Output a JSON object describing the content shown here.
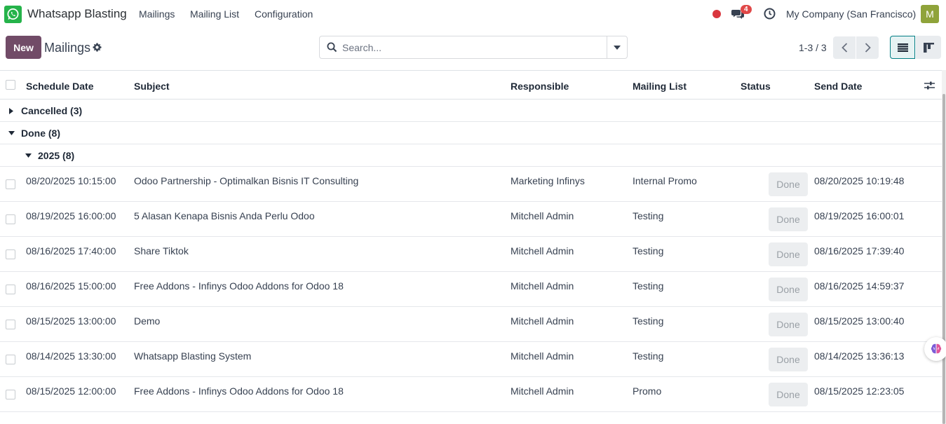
{
  "app": {
    "name": "Whatsapp Blasting"
  },
  "menu": [
    {
      "label": "Mailings"
    },
    {
      "label": "Mailing List"
    },
    {
      "label": "Configuration"
    }
  ],
  "systray": {
    "chat_count": "4",
    "company": "My Company (San Francisco)",
    "avatar_letter": "M"
  },
  "control": {
    "new_label": "New",
    "title": "Mailings",
    "search_placeholder": "Search...",
    "pager": "1-3 / 3"
  },
  "columns": {
    "schedule_date": "Schedule Date",
    "subject": "Subject",
    "responsible": "Responsible",
    "mailing_list": "Mailing List",
    "status": "Status",
    "send_date": "Send Date"
  },
  "groups": {
    "cancelled": "Cancelled (3)",
    "done": "Done (8)",
    "year": "2025 (8)"
  },
  "rows": [
    {
      "schedule_date": "08/20/2025 10:15:00",
      "subject": "Odoo Partnership - Optimalkan Bisnis IT Consulting",
      "responsible": "Marketing Infinys",
      "mailing_list": "Internal Promo",
      "status": "Done",
      "send_date": "08/20/2025 10:19:48"
    },
    {
      "schedule_date": "08/19/2025 16:00:00",
      "subject": "5 Alasan Kenapa Bisnis Anda Perlu Odoo",
      "responsible": "Mitchell Admin",
      "mailing_list": "Testing",
      "status": "Done",
      "send_date": "08/19/2025 16:00:01"
    },
    {
      "schedule_date": "08/16/2025 17:40:00",
      "subject": "Share Tiktok",
      "responsible": "Mitchell Admin",
      "mailing_list": "Testing",
      "status": "Done",
      "send_date": "08/16/2025 17:39:40"
    },
    {
      "schedule_date": "08/16/2025 15:00:00",
      "subject": "Free Addons - Infinys Odoo Addons for Odoo 18",
      "responsible": "Mitchell Admin",
      "mailing_list": "Testing",
      "status": "Done",
      "send_date": "08/16/2025 14:59:37"
    },
    {
      "schedule_date": "08/15/2025 13:00:00",
      "subject": "Demo",
      "responsible": "Mitchell Admin",
      "mailing_list": "Testing",
      "status": "Done",
      "send_date": "08/15/2025 13:00:40"
    },
    {
      "schedule_date": "08/14/2025 13:30:00",
      "subject": "Whatsapp Blasting System",
      "responsible": "Mitchell Admin",
      "mailing_list": "Testing",
      "status": "Done",
      "send_date": "08/14/2025 13:36:13"
    },
    {
      "schedule_date": "08/15/2025 12:00:00",
      "subject": "Free Addons - Infinys Odoo Addons for Odoo 18",
      "responsible": "Mitchell Admin",
      "mailing_list": "Promo",
      "status": "Done",
      "send_date": "08/15/2025 12:23:05"
    }
  ]
}
